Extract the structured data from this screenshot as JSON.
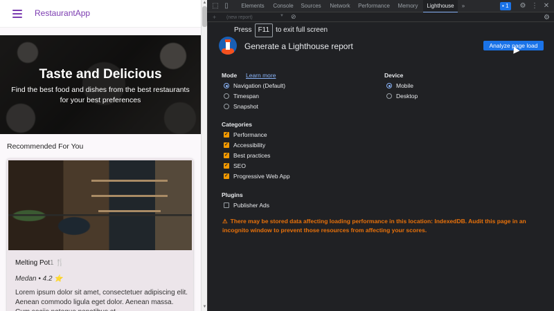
{
  "app": {
    "title": "RestaurantApp",
    "hero": {
      "title": "Taste and Delicious",
      "subtitle": "Find the best food and dishes from the best restaurants for your best preferences"
    },
    "recommended_title": "Recommended For You",
    "card": {
      "name": "Melting Pot",
      "name_suffix": "1 🍴",
      "city": "Medan",
      "rating": "4.2",
      "rating_icon": "⭐",
      "meta_separator": "•",
      "description": "Lorem ipsum dolor sit amet, consectetuer adipiscing elit. Aenean commodo ligula eget dolor. Aenean massa. Cum sociis natoque penatibus et"
    }
  },
  "devtools": {
    "tabs": [
      "Elements",
      "Console",
      "Sources",
      "Network",
      "Performance",
      "Memory",
      "Lighthouse"
    ],
    "active_tab": "Lighthouse",
    "more_tabs_glyph": "»",
    "issues_count": "1",
    "toolbar": {
      "report_select": "(new report)"
    },
    "fullscreen_hint": {
      "before": "Press",
      "key": "F11",
      "after": "to exit full screen"
    },
    "lighthouse": {
      "title": "Generate a Lighthouse report",
      "analyze_button": "Analyze page load",
      "mode": {
        "label": "Mode",
        "learn_more": "Learn more",
        "options": [
          {
            "label": "Navigation (Default)",
            "selected": true
          },
          {
            "label": "Timespan",
            "selected": false
          },
          {
            "label": "Snapshot",
            "selected": false
          }
        ]
      },
      "device": {
        "label": "Device",
        "options": [
          {
            "label": "Mobile",
            "selected": true
          },
          {
            "label": "Desktop",
            "selected": false
          }
        ]
      },
      "categories": {
        "label": "Categories",
        "items": [
          {
            "label": "Performance",
            "checked": true
          },
          {
            "label": "Accessibility",
            "checked": true
          },
          {
            "label": "Best practices",
            "checked": true
          },
          {
            "label": "SEO",
            "checked": true
          },
          {
            "label": "Progressive Web App",
            "checked": true
          }
        ]
      },
      "plugins": {
        "label": "Plugins",
        "items": [
          {
            "label": "Publisher Ads",
            "checked": false
          }
        ]
      },
      "warning": "There may be stored data affecting loading performance in this location: IndexedDB. Audit this page in an incognito window to prevent those resources from affecting your scores."
    }
  },
  "colors": {
    "app_accent": "#7b3bb0",
    "devtools_bg": "#202124",
    "primary_button": "#1a73e8",
    "checkbox_checked": "#f29900",
    "warning": "#e8710a",
    "link": "#8ab4f8"
  }
}
